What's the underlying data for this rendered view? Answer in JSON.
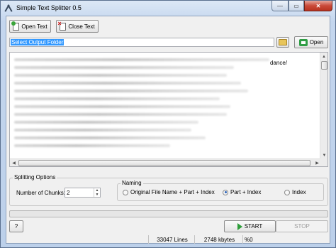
{
  "window": {
    "title": "Simple Text Splitter 0.5",
    "controls": {
      "minimize": "—",
      "maximize": "▭",
      "close": "✕"
    }
  },
  "toolbar": {
    "open_text_label": "Open Text",
    "close_text_label": "Close Text"
  },
  "output": {
    "folder_value": "Select Output Folder",
    "open_label": "Open"
  },
  "text_preview": {
    "visible_fragment": "dance/",
    "blurred_line_count": 12
  },
  "splitting_options": {
    "group_label": "Splitting Options",
    "chunks_label": "Number of Chunks:",
    "chunks_value": "2"
  },
  "naming": {
    "group_label": "Naming",
    "options": [
      {
        "label": "Original File Name + Part + Index",
        "selected": false
      },
      {
        "label": "Part + Index",
        "selected": true
      },
      {
        "label": "Index",
        "selected": false
      }
    ]
  },
  "progress": {
    "fraction": 0
  },
  "actions": {
    "help_label": "?",
    "start_label": "START",
    "stop_label": "STOP"
  },
  "status": {
    "lines": "33047 Lines",
    "size": "2748 kbytes",
    "percent": "%0"
  },
  "colors": {
    "selection": "#3399ff",
    "start_icon": "#2e9e3a",
    "close_button": "#c94a3a"
  }
}
